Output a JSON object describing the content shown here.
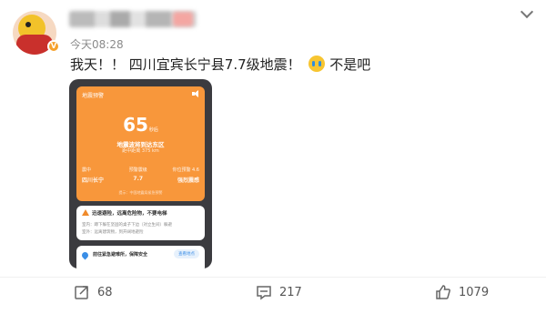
{
  "post": {
    "time": "今天08:28",
    "text": "我天！！ 四川宜宾长宁县7.7级地震！",
    "text_tail": "不是吧",
    "verified_badge": "V"
  },
  "alert_card": {
    "title": "地震预警",
    "countdown": "65",
    "countdown_unit": "秒后",
    "place": "地震波将到达东区",
    "distance": "距中距离 375 km",
    "col1_label": "震中",
    "col1_value": "四川长宁",
    "col2_label": "预警震级",
    "col2_value": "7.7",
    "col3_label": "你位预警 4.6",
    "col3_value": "强烈震感",
    "footer": "提示：中国地震局紧急预警"
  },
  "tips": {
    "warning": "迅速避险，远离危险物，不要电梯",
    "line1": "室内：蹲下躲在坚固的桌子下边（对立生间）躲避",
    "line2": "室外：远离建筑物，到开阔地避险"
  },
  "shelter": {
    "text": "前往紧急避难所，保障安全",
    "button": "查看地点"
  },
  "actions": {
    "repost_count": "68",
    "comment_count": "217",
    "like_count": "1079"
  },
  "icons": [
    "chevron-down-icon",
    "repost-icon",
    "comment-icon",
    "like-icon",
    "warning-icon",
    "sound-icon",
    "location-pin-icon"
  ],
  "colors": {
    "alert_orange": "#f8973b",
    "phone_bg": "#3b3b3f",
    "link_blue": "#3a8ee6"
  }
}
